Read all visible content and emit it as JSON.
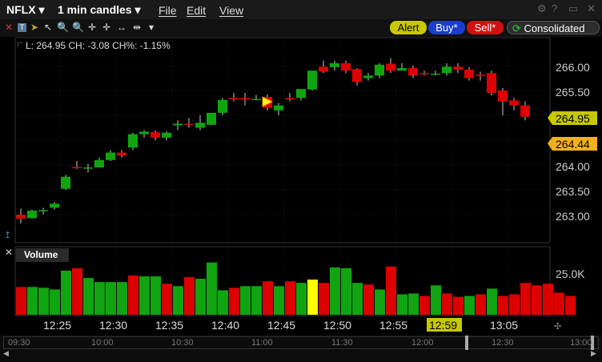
{
  "titlebar": {
    "symbol": "NFLX ▾",
    "timeframe": "1 min candles ▾",
    "menus": [
      "File",
      "Edit",
      "View"
    ]
  },
  "toolbar": {
    "alert": "Alert",
    "buy": "Buy*",
    "sell": "Sell*",
    "exchange": "Consolidated"
  },
  "status": {
    "text": "L: 264.95 CH: -3.08 CH%: -1.15%"
  },
  "price_tags": {
    "last": "264.95",
    "other": "264.44"
  },
  "volume": {
    "label": "Volume",
    "axis_label": "25.0K"
  },
  "x_axis": {
    "highlight": "12:59"
  },
  "history_axis": [
    "09:30",
    "10:00",
    "10:30",
    "11:00",
    "11:30",
    "12:00",
    "12:30",
    "13:00"
  ],
  "colors": {
    "up": "#11a411",
    "down": "#dd0000",
    "accent_yellow": "#ffff00",
    "alert_bg": "#c8c800",
    "buy_bg": "#1a3cd0",
    "sell_bg": "#d01010"
  },
  "chart_data": {
    "type": "candlestick",
    "x_tick_labels": [
      "12:25",
      "12:30",
      "12:35",
      "12:40",
      "12:45",
      "12:50",
      "12:55",
      "13:00",
      "13:05"
    ],
    "y_tick_labels": [
      "263.00",
      "263.50",
      "264.00",
      "264.50",
      "265.00",
      "265.50",
      "266.00"
    ],
    "ylim": [
      262.55,
      266.35
    ],
    "candles": [
      {
        "o": 263.0,
        "h": 263.12,
        "c": 262.92,
        "l": 262.82
      },
      {
        "o": 262.93,
        "h": 263.1,
        "c": 263.08,
        "l": 262.92
      },
      {
        "o": 263.09,
        "h": 263.14,
        "c": 263.09,
        "l": 263.0
      },
      {
        "o": 263.14,
        "h": 263.25,
        "c": 263.22,
        "l": 263.1
      },
      {
        "o": 263.52,
        "h": 263.8,
        "c": 263.76,
        "l": 263.5
      },
      {
        "o": 263.96,
        "h": 264.08,
        "c": 263.94,
        "l": 263.92
      },
      {
        "o": 263.94,
        "h": 264.02,
        "c": 263.95,
        "l": 263.85
      },
      {
        "o": 263.95,
        "h": 264.15,
        "c": 264.1,
        "l": 263.95
      },
      {
        "o": 264.1,
        "h": 264.3,
        "c": 264.25,
        "l": 264.08
      },
      {
        "o": 264.25,
        "h": 264.3,
        "c": 264.19,
        "l": 264.15
      },
      {
        "o": 264.35,
        "h": 264.65,
        "c": 264.62,
        "l": 264.3
      },
      {
        "o": 264.62,
        "h": 264.7,
        "c": 264.67,
        "l": 264.55
      },
      {
        "o": 264.66,
        "h": 264.7,
        "c": 264.55,
        "l": 264.5
      },
      {
        "o": 264.55,
        "h": 264.68,
        "c": 264.65,
        "l": 264.5
      },
      {
        "o": 264.8,
        "h": 264.9,
        "c": 264.83,
        "l": 264.7
      },
      {
        "o": 264.83,
        "h": 264.95,
        "c": 264.82,
        "l": 264.75
      },
      {
        "o": 264.75,
        "h": 265.0,
        "c": 264.85,
        "l": 264.7
      },
      {
        "o": 264.81,
        "h": 265.0,
        "c": 265.05,
        "l": 264.8
      },
      {
        "o": 265.05,
        "h": 265.35,
        "c": 265.31,
        "l": 265.0
      },
      {
        "o": 265.35,
        "h": 265.45,
        "c": 265.32,
        "l": 265.28
      },
      {
        "o": 265.35,
        "h": 265.45,
        "c": 265.32,
        "l": 265.2
      },
      {
        "o": 265.33,
        "h": 265.41,
        "c": 265.33,
        "l": 265.3
      },
      {
        "o": 265.37,
        "h": 265.42,
        "c": 265.15,
        "l": 265.1
      },
      {
        "o": 265.1,
        "h": 265.25,
        "c": 265.2,
        "l": 265.0
      },
      {
        "o": 265.35,
        "h": 265.45,
        "c": 265.32,
        "l": 265.28
      },
      {
        "o": 265.35,
        "h": 265.45,
        "c": 265.53,
        "l": 265.3
      },
      {
        "o": 265.52,
        "h": 265.9,
        "c": 265.9,
        "l": 265.5
      },
      {
        "o": 265.98,
        "h": 266.1,
        "c": 265.88,
        "l": 265.85
      },
      {
        "o": 265.97,
        "h": 266.1,
        "c": 266.05,
        "l": 265.9
      },
      {
        "o": 266.05,
        "h": 266.1,
        "c": 265.9,
        "l": 265.85
      },
      {
        "o": 265.93,
        "h": 265.95,
        "c": 265.67,
        "l": 265.6
      },
      {
        "o": 265.75,
        "h": 265.85,
        "c": 265.8,
        "l": 265.7
      },
      {
        "o": 265.8,
        "h": 266.05,
        "c": 266.02,
        "l": 265.75
      },
      {
        "o": 266.04,
        "h": 266.15,
        "c": 265.9,
        "l": 265.85
      },
      {
        "o": 265.9,
        "h": 266.05,
        "c": 265.95,
        "l": 265.9
      },
      {
        "o": 265.95,
        "h": 266.0,
        "c": 265.8,
        "l": 265.75
      },
      {
        "o": 265.85,
        "h": 265.9,
        "c": 265.83,
        "l": 265.8
      },
      {
        "o": 265.83,
        "h": 265.9,
        "c": 265.84,
        "l": 265.8
      },
      {
        "o": 265.85,
        "h": 266.05,
        "c": 265.98,
        "l": 265.8
      },
      {
        "o": 265.98,
        "h": 266.05,
        "c": 265.92,
        "l": 265.85
      },
      {
        "o": 265.92,
        "h": 265.97,
        "c": 265.75,
        "l": 265.7
      },
      {
        "o": 265.82,
        "h": 265.88,
        "c": 265.8,
        "l": 265.7
      },
      {
        "o": 265.85,
        "h": 265.9,
        "c": 265.45,
        "l": 265.4
      },
      {
        "o": 265.5,
        "h": 265.55,
        "c": 265.28,
        "l": 265.0
      },
      {
        "o": 265.3,
        "h": 265.35,
        "c": 265.2,
        "l": 265.1
      },
      {
        "o": 265.2,
        "h": 265.28,
        "c": 264.97,
        "l": 264.9
      }
    ],
    "volume_axis_label": "25.0K",
    "volume": [
      {
        "v": 17000,
        "up": false
      },
      {
        "v": 17000,
        "up": true
      },
      {
        "v": 16500,
        "up": true
      },
      {
        "v": 15500,
        "up": true
      },
      {
        "v": 27000,
        "up": true
      },
      {
        "v": 28500,
        "up": false
      },
      {
        "v": 22500,
        "up": true
      },
      {
        "v": 20000,
        "up": true
      },
      {
        "v": 20000,
        "up": true
      },
      {
        "v": 20000,
        "up": true
      },
      {
        "v": 24000,
        "up": false
      },
      {
        "v": 23500,
        "up": true
      },
      {
        "v": 23500,
        "up": true
      },
      {
        "v": 19000,
        "up": false
      },
      {
        "v": 17500,
        "up": true
      },
      {
        "v": 23000,
        "up": false
      },
      {
        "v": 22000,
        "up": true
      },
      {
        "v": 32000,
        "up": true
      },
      {
        "v": 15000,
        "up": true
      },
      {
        "v": 16500,
        "up": false
      },
      {
        "v": 17500,
        "up": true
      },
      {
        "v": 17500,
        "up": true
      },
      {
        "v": 20500,
        "up": false
      },
      {
        "v": 17500,
        "up": true
      },
      {
        "v": 20500,
        "up": false
      },
      {
        "v": 19500,
        "up": true
      },
      {
        "v": 21500,
        "up": true,
        "highlight": true
      },
      {
        "v": 19500,
        "up": false
      },
      {
        "v": 29000,
        "up": true
      },
      {
        "v": 28500,
        "up": true
      },
      {
        "v": 19500,
        "up": true
      },
      {
        "v": 18500,
        "up": false
      },
      {
        "v": 15500,
        "up": true
      },
      {
        "v": 29500,
        "up": false
      },
      {
        "v": 12500,
        "up": true
      },
      {
        "v": 13000,
        "up": true
      },
      {
        "v": 11500,
        "up": false
      },
      {
        "v": 18000,
        "up": true
      },
      {
        "v": 13000,
        "up": false
      },
      {
        "v": 11000,
        "up": false
      },
      {
        "v": 11500,
        "up": true
      },
      {
        "v": 12500,
        "up": false
      },
      {
        "v": 16000,
        "up": true
      },
      {
        "v": 11500,
        "up": false
      },
      {
        "v": 12500,
        "up": false
      },
      {
        "v": 19500,
        "up": false
      },
      {
        "v": 18000,
        "up": false
      },
      {
        "v": 19000,
        "up": false
      },
      {
        "v": 13500,
        "up": false
      },
      {
        "v": 11500,
        "up": false
      }
    ]
  }
}
